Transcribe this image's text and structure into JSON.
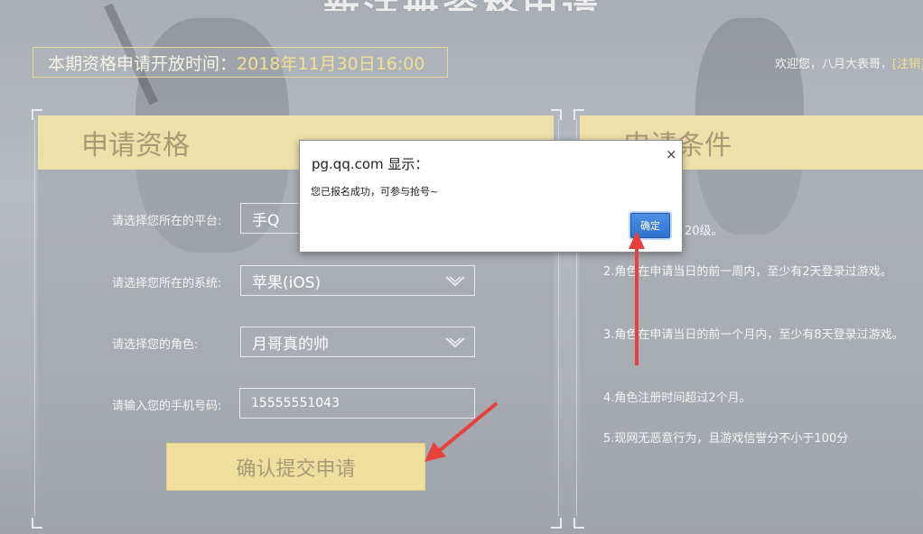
{
  "header": {
    "title": "新注册资格申请"
  },
  "period": {
    "label": "本期资格申请开放时间：",
    "time": "2018年11月30日16:00"
  },
  "welcome": {
    "text": "欢迎您，八月大表哥，",
    "link": "[注销]"
  },
  "left_panel": {
    "title": "申请资格",
    "fields": [
      {
        "label": "请选择您所在的平台:",
        "value": "手Q"
      },
      {
        "label": "请选择您所在的系统:",
        "value": "苹果(iOS)"
      },
      {
        "label": "请选择您的角色:",
        "value": "月哥真的帅"
      },
      {
        "label": "请输入您的手机号码:",
        "value": "15555551043"
      }
    ],
    "submit": "确认提交申请"
  },
  "right_panel": {
    "title": "申请条件",
    "conditions": [
      "20级。",
      "2.角色在申请当日的前一周内，至少有2天登录过游戏。",
      "3.角色在申请当日的前一个月内，至少有8天登录过游戏。",
      "4.角色注册时间超过2个月。",
      "5.现网无恶意行为，且游戏信誉分不小于100分"
    ]
  },
  "dialog": {
    "title": "pg.qq.com 显示：",
    "message": "您已报名成功，可参与抢号~",
    "ok": "确定",
    "close": "×"
  },
  "colors": {
    "accent_gold": "#eee0a9",
    "highlight": "#f3df92",
    "arrow": "#e8403a",
    "ok_blue": "#2f72cf"
  }
}
